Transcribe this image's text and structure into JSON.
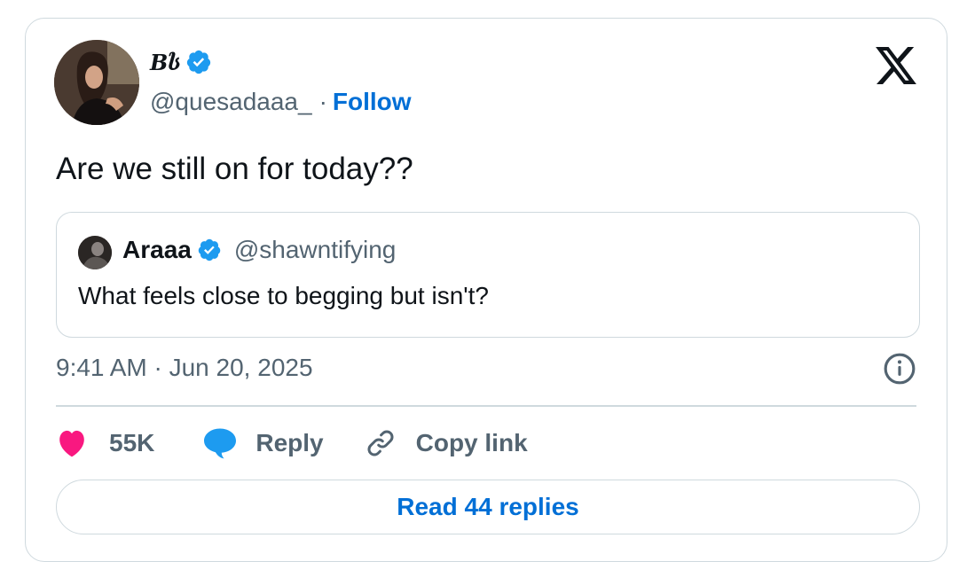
{
  "author": {
    "display_name": "Bს",
    "handle": "@quesadaaa_",
    "separator": "·",
    "follow_label": "Follow"
  },
  "tweet": {
    "text": "Are we still on for today??",
    "timestamp": "9:41 AM · Jun 20, 2025"
  },
  "quoted": {
    "display_name": "Araaa",
    "handle": "@shawntifying",
    "text": "What feels close to begging but isn't?"
  },
  "actions": {
    "like_count": "55K",
    "reply_label": "Reply",
    "copy_link_label": "Copy link",
    "read_replies_label": "Read 44 replies"
  },
  "icons": {
    "logo": "x-logo-icon",
    "verified": "verified-badge-icon",
    "info": "info-icon",
    "like": "heart-icon",
    "reply": "speech-bubble-icon",
    "copy_link": "link-icon"
  },
  "colors": {
    "link_blue": "#006fd6",
    "verified_blue": "#1d9bf0",
    "heart_pink": "#f91880",
    "muted_text": "#536471",
    "border": "#cfd9de"
  }
}
